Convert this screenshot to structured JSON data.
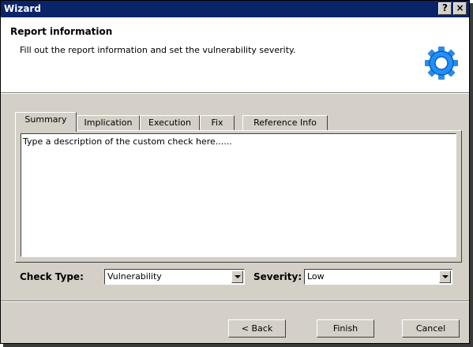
{
  "window": {
    "title": "Wizard",
    "help_label": "?",
    "close_label": "×"
  },
  "header": {
    "title": "Report information",
    "subtitle": "Fill out the report information and set the vulnerability severity.",
    "icon": "gear-icon"
  },
  "tabs": [
    {
      "label": "Summary",
      "active": true
    },
    {
      "label": "Implication",
      "active": false
    },
    {
      "label": "Execution",
      "active": false
    },
    {
      "label": "Fix",
      "active": false
    },
    {
      "label": "Reference Info",
      "active": false
    }
  ],
  "summary": {
    "text": "Type a description of the custom check here......"
  },
  "check_type": {
    "label": "Check Type:",
    "value": "Vulnerability"
  },
  "severity": {
    "label": "Severity:",
    "value": "Low"
  },
  "buttons": {
    "back": "< Back",
    "finish": "Finish",
    "cancel": "Cancel"
  },
  "colors": {
    "titlebar": "#0a246a",
    "face": "#d4d0c8",
    "gear": "#1e90ff"
  }
}
